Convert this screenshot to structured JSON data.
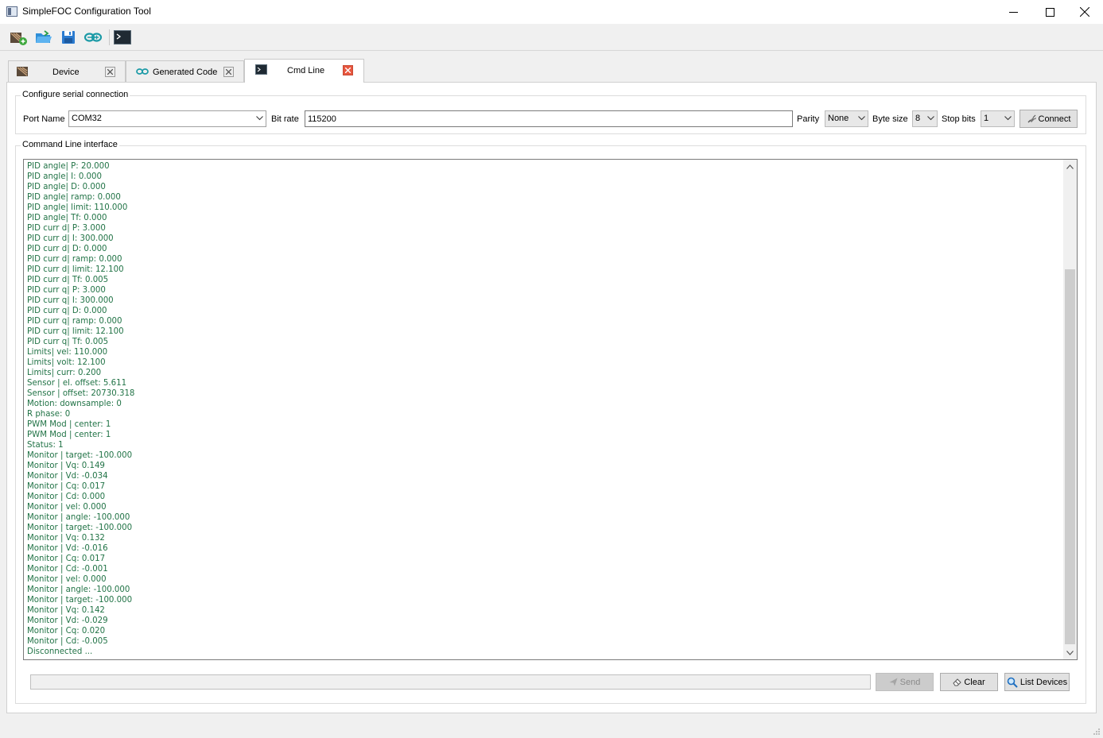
{
  "window": {
    "title": "SimpleFOC Configuration Tool"
  },
  "toolbar": {
    "buttons": [
      {
        "name": "new-device-icon"
      },
      {
        "name": "open-icon"
      },
      {
        "name": "save-icon"
      },
      {
        "name": "arduino-code-icon"
      },
      {
        "name": "terminal-icon"
      }
    ]
  },
  "tabs": [
    {
      "label": "Device",
      "icon": "motor-icon",
      "active": false
    },
    {
      "label": "Generated Code",
      "icon": "arduino-icon",
      "active": false
    },
    {
      "label": "Cmd Line",
      "icon": "terminal-icon",
      "active": true
    }
  ],
  "serial": {
    "group_title": "Configure serial connection",
    "port_label": "Port Name",
    "port_value": "COM32",
    "bitrate_label": "Bit rate",
    "bitrate_value": "115200",
    "parity_label": "Parity",
    "parity_value": "None",
    "bytesize_label": "Byte size",
    "bytesize_value": "8",
    "stopbits_label": "Stop bits",
    "stopbits_value": "1",
    "connect_label": "Connect"
  },
  "cli": {
    "group_title": "Command Line interface",
    "lines": [
      "PID angle| P: 20.000",
      "PID angle| I: 0.000",
      "PID angle| D: 0.000",
      "PID angle| ramp: 0.000",
      "PID angle| limit: 110.000",
      "PID angle| Tf: 0.000",
      "PID curr d| P: 3.000",
      "PID curr d| I: 300.000",
      "PID curr d| D: 0.000",
      "PID curr d| ramp: 0.000",
      "PID curr d| limit: 12.100",
      "PID curr d| Tf: 0.005",
      "PID curr q| P: 3.000",
      "PID curr q| I: 300.000",
      "PID curr q| D: 0.000",
      "PID curr q| ramp: 0.000",
      "PID curr q| limit: 12.100",
      "PID curr q| Tf: 0.005",
      "Limits| vel: 110.000",
      "Limits| volt: 12.100",
      "Limits| curr: 0.200",
      "Sensor | el. offset: 5.611",
      "Sensor | offset: 20730.318",
      "Motion: downsample: 0",
      "R phase: 0",
      "PWM Mod | center: 1",
      "PWM Mod | center: 1",
      "Status: 1",
      "Monitor | target: -100.000",
      "Monitor | Vq: 0.149",
      "Monitor | Vd: -0.034",
      "Monitor | Cq: 0.017",
      "Monitor | Cd: 0.000",
      "Monitor | vel: 0.000",
      "Monitor | angle: -100.000",
      "Monitor | target: -100.000",
      "Monitor | Vq: 0.132",
      "Monitor | Vd: -0.016",
      "Monitor | Cq: 0.017",
      "Monitor | Cd: -0.001",
      "Monitor | vel: 0.000",
      "Monitor | angle: -100.000",
      "Monitor | target: -100.000",
      "Monitor | Vq: 0.142",
      "Monitor | Vd: -0.029",
      "Monitor | Cq: 0.020",
      "Monitor | Cd: -0.005",
      "Disconnected ..."
    ],
    "command_value": "",
    "send_label": "Send",
    "clear_label": "Clear",
    "list_devices_label": "List Devices"
  },
  "colors": {
    "console_text": "#217346",
    "close_active": "#e8563f"
  }
}
